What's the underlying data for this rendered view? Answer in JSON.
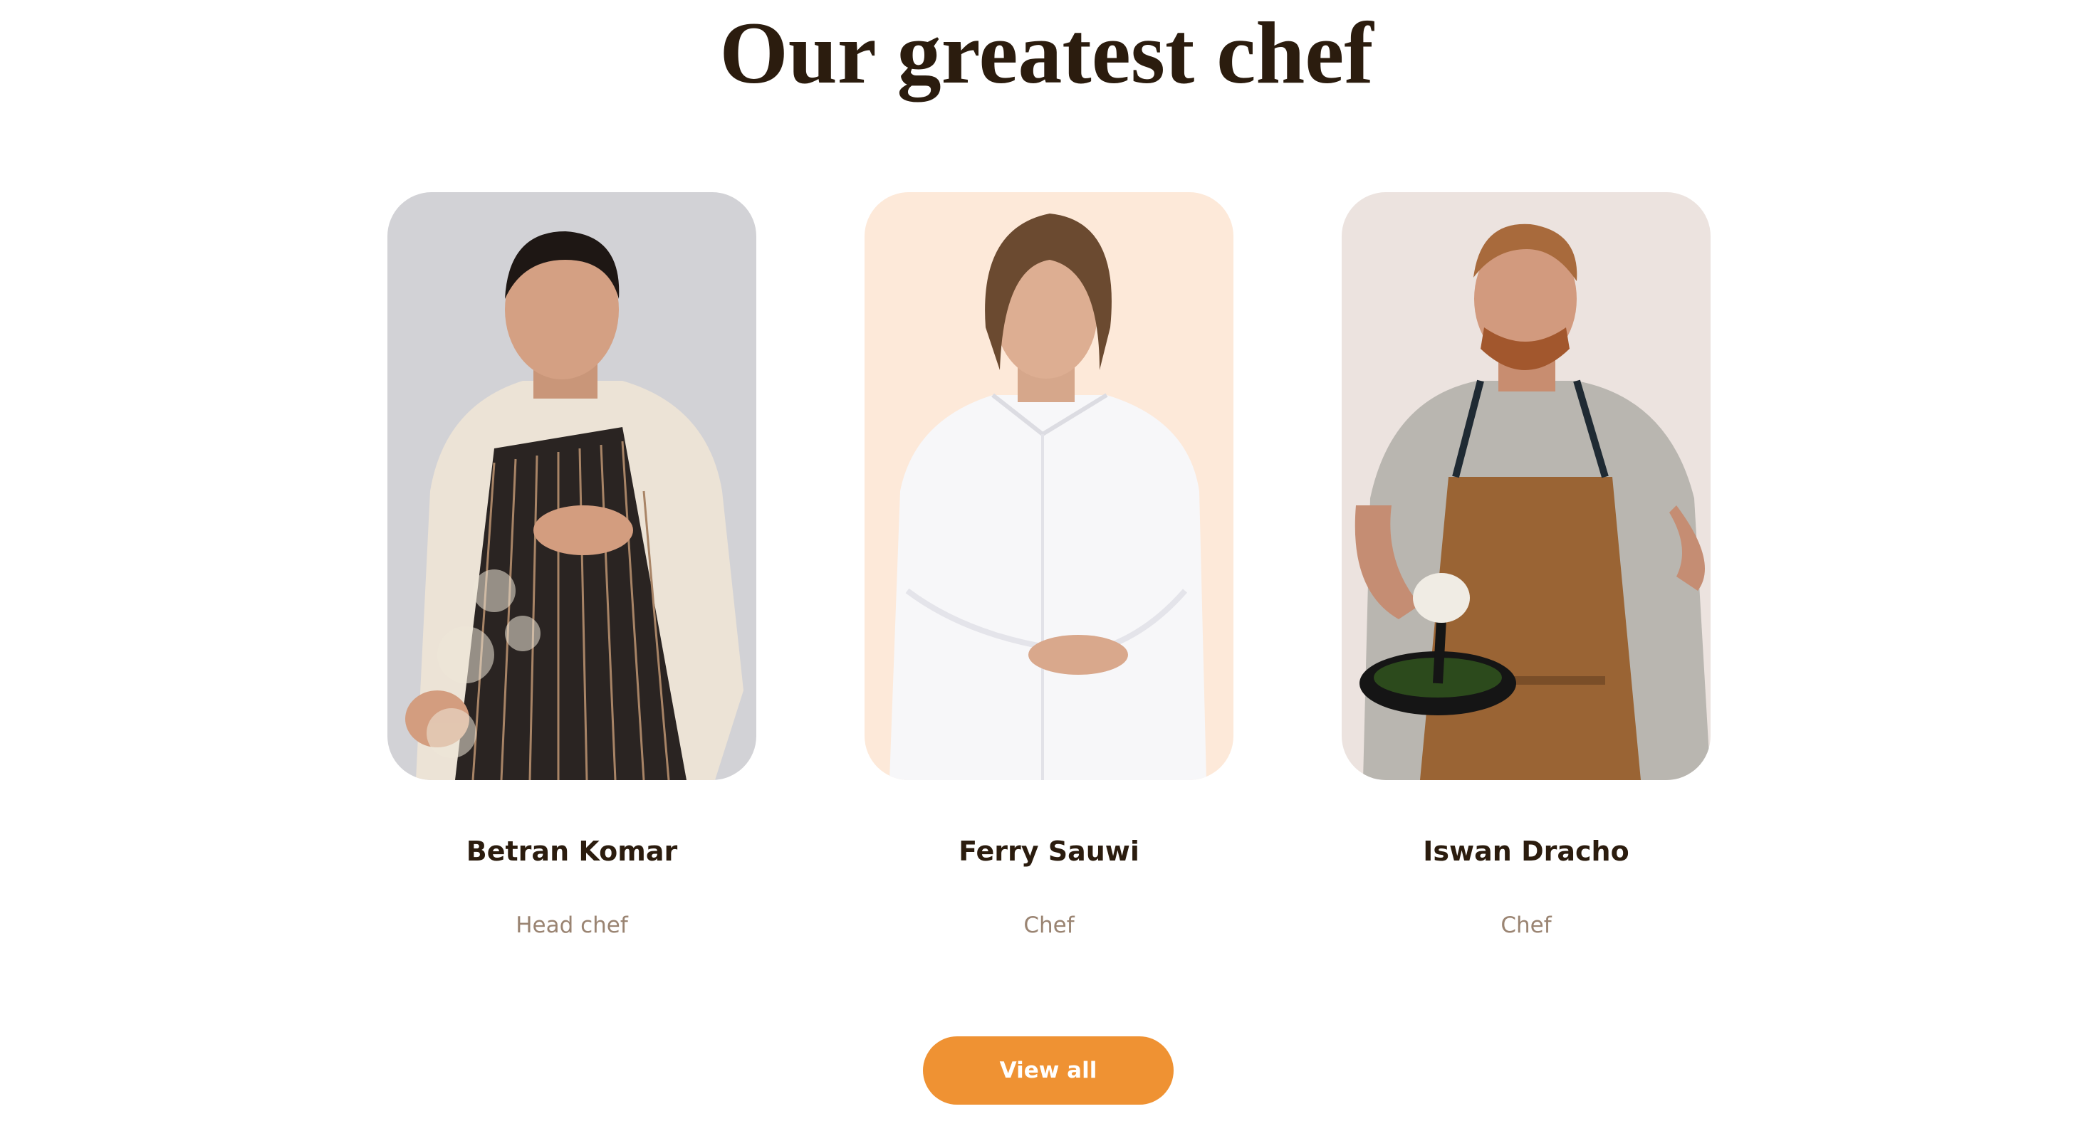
{
  "section": {
    "title": "Our greatest chef"
  },
  "chefs": [
    {
      "name": "Betran Komar",
      "role": "Head chef",
      "photo_bg": "#d2d2d6",
      "outfit": "chef jacket with striped apron"
    },
    {
      "name": "Ferry Sauwi",
      "role": "Chef",
      "photo_bg": "#fde9d9",
      "outfit": "white chef jacket"
    },
    {
      "name": "Iswan Dracho",
      "role": "Chef",
      "photo_bg": "#ece3df",
      "outfit": "grey t-shirt with brown apron holding pan"
    }
  ],
  "actions": {
    "view_all_label": "View all"
  },
  "colors": {
    "heading": "#2b1c0e",
    "role_text": "#9a8472",
    "button": "#ef9233",
    "button_text": "#ffffff"
  }
}
